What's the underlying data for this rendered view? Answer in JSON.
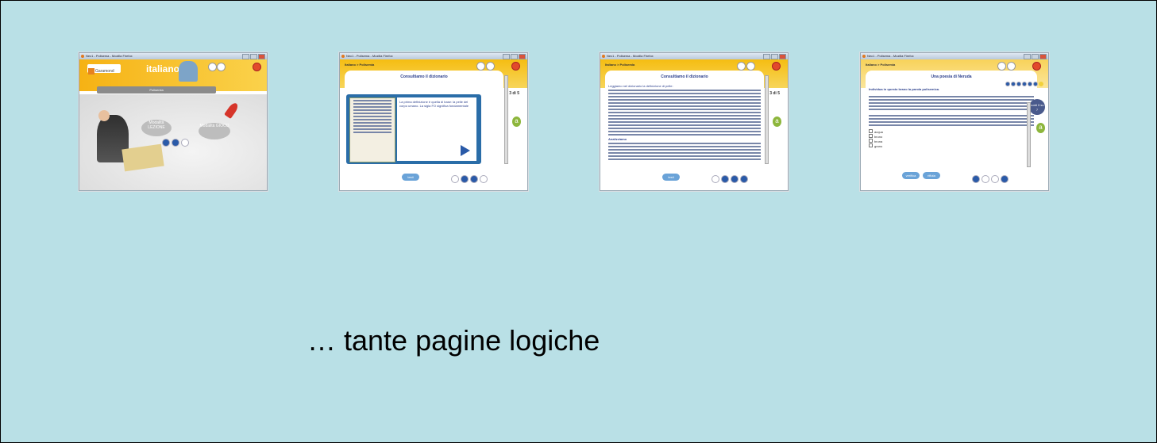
{
  "slide": {
    "caption": "… tante pagine logiche"
  },
  "thumbnails": [
    {
      "window_title": "Nec1 - Polisema - Mozilla Firefox",
      "brand": "Garamond",
      "heading": "italiano",
      "bar_label": "Polisemia",
      "cloud_left": "Modalità LEZIONE",
      "cloud_right": "Modalità GIOCO"
    },
    {
      "window_title": "Nec1 - Polisema - Mozilla Firefox",
      "breadcrumb": "Italiano > Polisemia",
      "page_title": "Consultiamo il dizionario",
      "counter": "3 di 5",
      "panel_text": "La prima definizione è quella di base: la pelle del corpo umano. La sigla FO significa fondamentale",
      "button": "testi"
    },
    {
      "window_title": "Nec1 - Polisema - Mozilla Firefox",
      "breadcrumb": "Italiano > Polisemia",
      "page_title": "Consultiamo il dizionario",
      "counter": "3 di 5",
      "intro": "Leggiamo nel dizionario la definizione di pelle:",
      "section": "Analizziamo",
      "button": "testi"
    },
    {
      "window_title": "Nec1 - Polisema - Mozilla Firefox",
      "breadcrumb": "Italiano > Polisemia",
      "page_title": "Una poesia di Neruda",
      "instruction": "Individua in questo brano la parola polisemica.",
      "options": [
        "acqua",
        "bruno",
        "bruna",
        "grano"
      ],
      "badge": "punti 0 su 7",
      "button_verify": "verifica",
      "button_redo": "rifiuta"
    }
  ],
  "colors": {
    "background": "#b9e0e6",
    "band_yellow": "#f5bd12",
    "accent_blue": "#2a5aa8",
    "accent_green": "#8db63c"
  }
}
